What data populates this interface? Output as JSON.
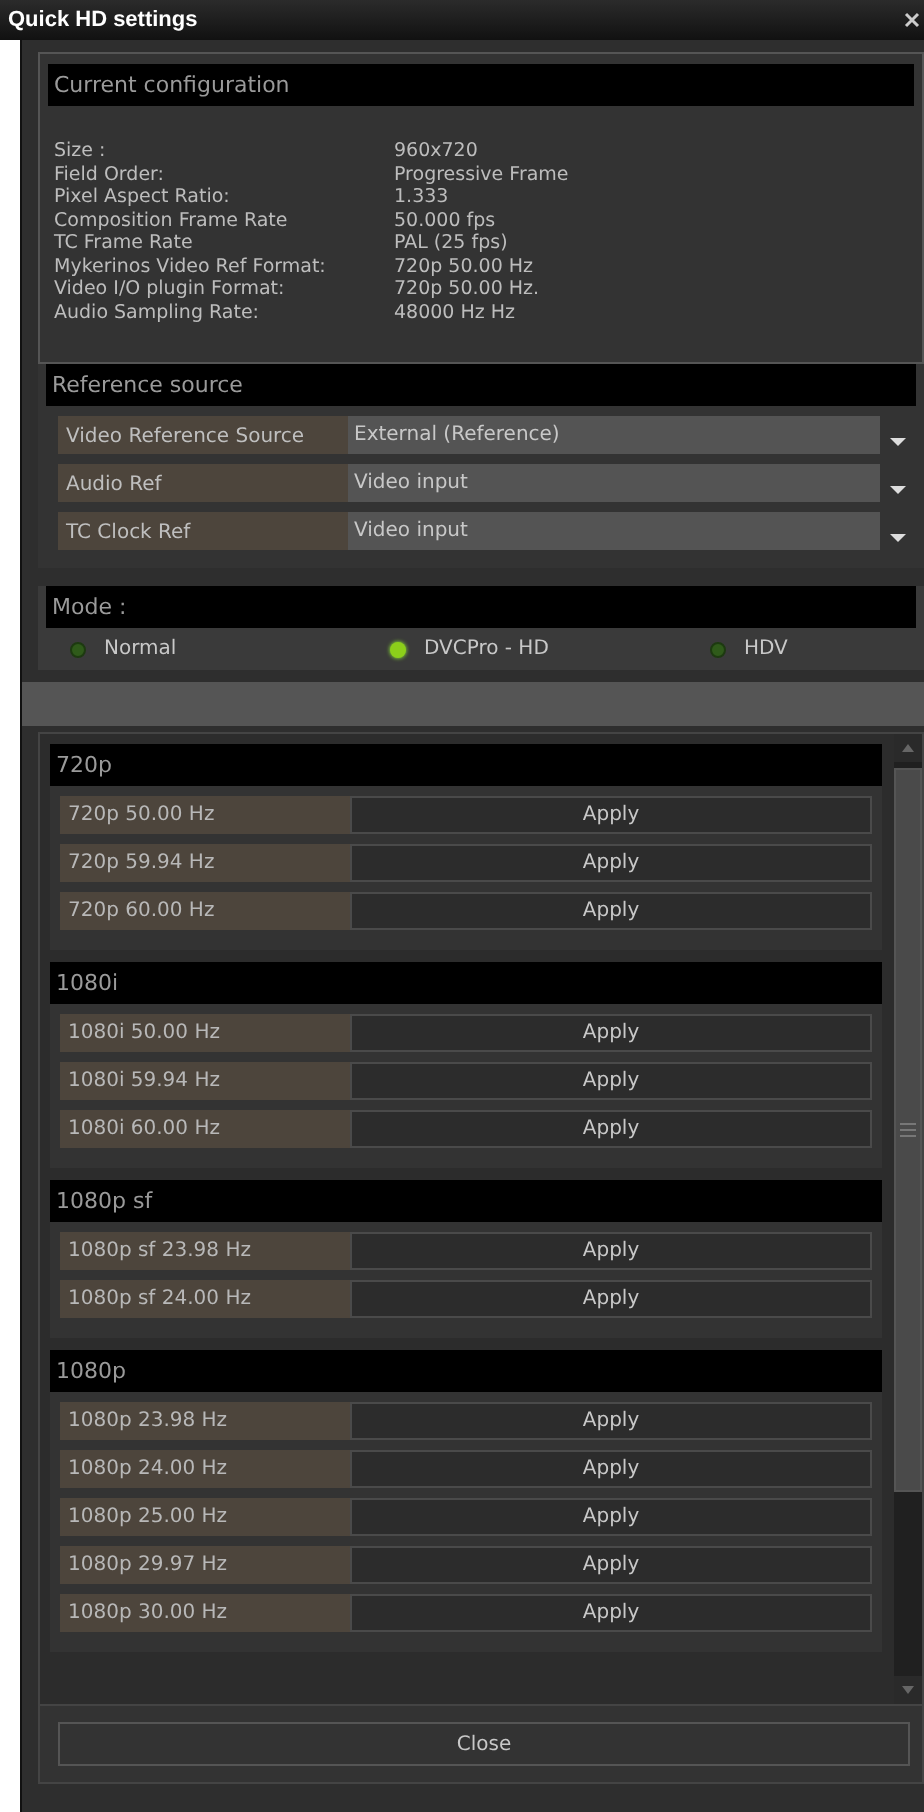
{
  "window": {
    "title": "Quick HD settings"
  },
  "current_configuration": {
    "title": "Current configuration",
    "rows": [
      {
        "label": "Size :",
        "value": "960x720"
      },
      {
        "label": "Field Order:",
        "value": "Progressive Frame"
      },
      {
        "label": "Pixel Aspect Ratio:",
        "value": "1.333"
      },
      {
        "label": "Composition Frame Rate",
        "value": "50.000 fps"
      },
      {
        "label": "TC Frame Rate",
        "value": "PAL (25 fps)"
      },
      {
        "label": "Mykerinos Video Ref Format:",
        "value": "720p 50.00 Hz"
      },
      {
        "label": "Video I/O plugin Format:",
        "value": "720p 50.00 Hz."
      },
      {
        "label": "Audio Sampling Rate:",
        "value": "48000 Hz Hz"
      }
    ]
  },
  "reference_source": {
    "title": "Reference source",
    "rows": [
      {
        "label": "Video Reference Source",
        "value": "External (Reference)"
      },
      {
        "label": "Audio Ref",
        "value": "Video input"
      },
      {
        "label": "TC Clock Ref",
        "value": "Video input"
      }
    ]
  },
  "mode": {
    "title": "Mode :",
    "options": [
      {
        "label": "Normal",
        "selected": false
      },
      {
        "label": "DVCPro - HD",
        "selected": true
      },
      {
        "label": "HDV",
        "selected": false
      }
    ]
  },
  "formats": [
    {
      "title": "720p",
      "rows": [
        {
          "label": "720p 50.00 Hz",
          "button": "Apply"
        },
        {
          "label": "720p 59.94 Hz",
          "button": "Apply"
        },
        {
          "label": "720p 60.00 Hz",
          "button": "Apply"
        }
      ]
    },
    {
      "title": "1080i",
      "rows": [
        {
          "label": "1080i 50.00 Hz",
          "button": "Apply"
        },
        {
          "label": "1080i 59.94 Hz",
          "button": "Apply"
        },
        {
          "label": "1080i 60.00 Hz",
          "button": "Apply"
        }
      ]
    },
    {
      "title": "1080p sf",
      "rows": [
        {
          "label": "1080p sf 23.98 Hz",
          "button": "Apply"
        },
        {
          "label": "1080p sf 24.00 Hz",
          "button": "Apply"
        }
      ]
    },
    {
      "title": "1080p",
      "rows": [
        {
          "label": "1080p 23.98 Hz",
          "button": "Apply"
        },
        {
          "label": "1080p 24.00 Hz",
          "button": "Apply"
        },
        {
          "label": "1080p 25.00 Hz",
          "button": "Apply"
        },
        {
          "label": "1080p 29.97 Hz",
          "button": "Apply"
        },
        {
          "label": "1080p 30.00 Hz",
          "button": "Apply"
        }
      ]
    }
  ],
  "close_button": "Close"
}
